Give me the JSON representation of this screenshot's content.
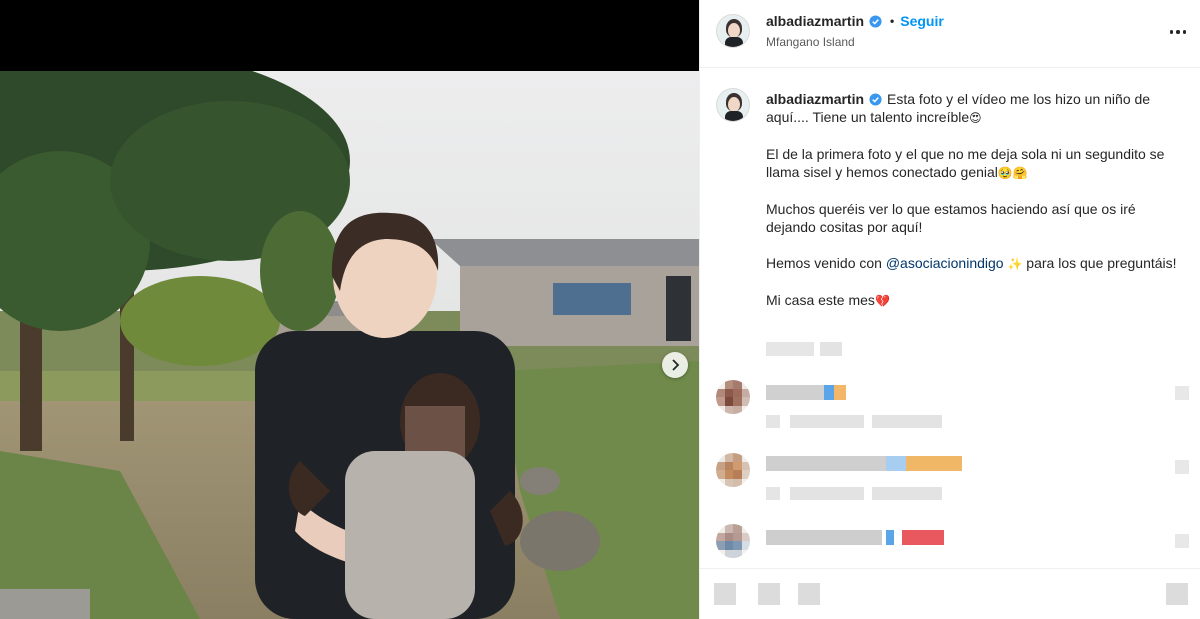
{
  "post": {
    "username": "albadiazmartin",
    "follow_label": "Seguir",
    "dot": "•",
    "location": "Mfangano Island"
  },
  "caption": {
    "username": "albadiazmartin",
    "p1": "Esta foto y el vídeo me los hizo un niño de aquí.... Tiene un talento increíble",
    "p1_emoji": "😍",
    "p2": "El de la primera foto y el que no me deja sola ni un segundito se llama sisel y hemos conectado genial",
    "p2_emoji": "🥹🤗",
    "p3": "Muchos queréis ver lo que estamos haciendo así que os iré dejando cositas por aquí!",
    "p4_pre": "Hemos venido con ",
    "p4_mention": "@asociacionindigo",
    "p4_emoji": "✨",
    "p4_post": " para los que preguntáis!",
    "p5": "Mi casa este mes",
    "p5_emoji": "💔"
  },
  "icons": {
    "verified": "verified-badge-icon",
    "more": "more-options-icon",
    "next": "chevron-right-icon"
  },
  "colors": {
    "accent": "#0095f6",
    "mention": "#00376b",
    "verified": "#3897f0"
  }
}
